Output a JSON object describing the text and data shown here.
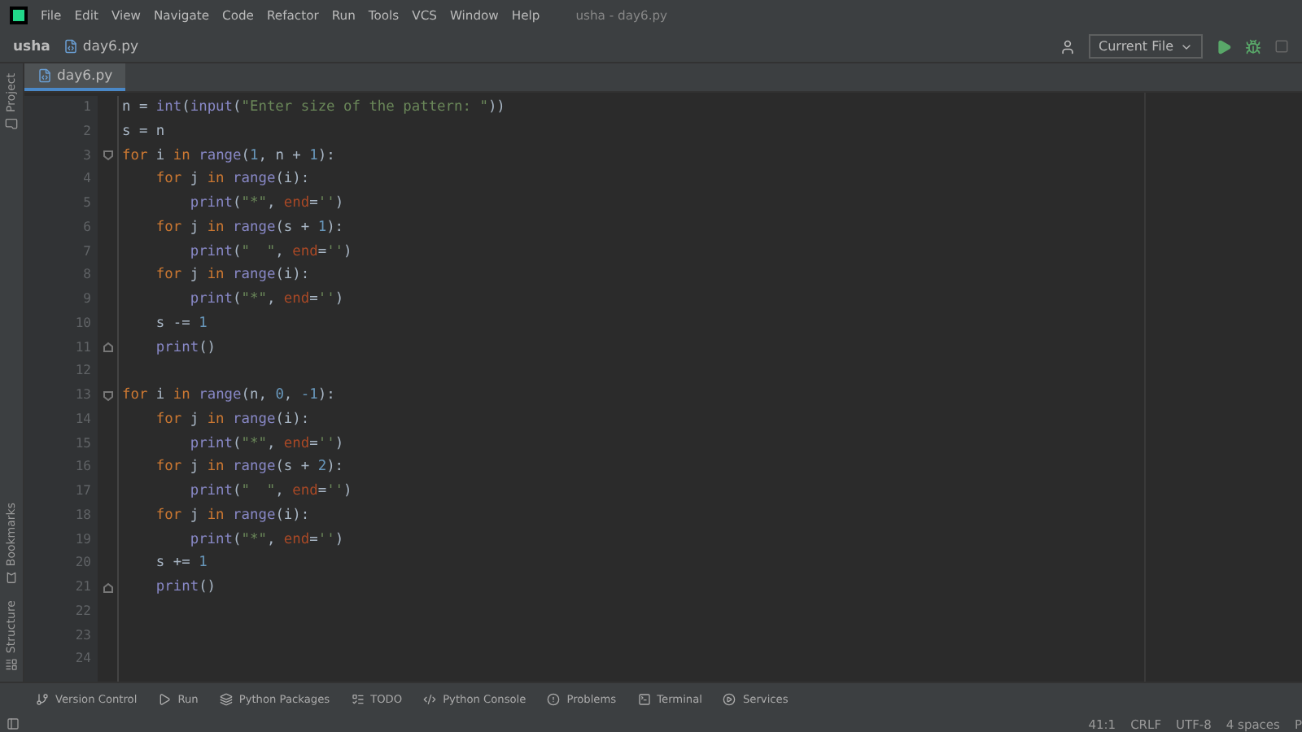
{
  "menu": [
    "File",
    "Edit",
    "View",
    "Navigate",
    "Code",
    "Refactor",
    "Run",
    "Tools",
    "VCS",
    "Window",
    "Help"
  ],
  "window": {
    "title": "usha - day6.py"
  },
  "navbar": {
    "project": "usha",
    "file": "day6.py",
    "run_config": "Current File"
  },
  "tabs": [
    {
      "label": "day6.py",
      "selected": true
    }
  ],
  "side_tools_top": [
    "Project"
  ],
  "side_tools_bottom": [
    "Bookmarks",
    "Structure"
  ],
  "editor": {
    "lines": [
      {
        "number": "1",
        "tokens": [
          {
            "kind": "plain",
            "t": "n = "
          },
          {
            "kind": "builtin",
            "t": "int"
          },
          {
            "kind": "plain",
            "t": "("
          },
          {
            "kind": "builtin",
            "t": "input"
          },
          {
            "kind": "plain",
            "t": "("
          },
          {
            "kind": "str",
            "t": "\"Enter size of the pattern: \""
          },
          {
            "kind": "plain",
            "t": "))"
          }
        ]
      },
      {
        "number": "2",
        "tokens": [
          {
            "kind": "plain",
            "t": "s = n"
          }
        ]
      },
      {
        "number": "3",
        "kind": "opener",
        "tokens": [
          {
            "kind": "kw",
            "t": "for"
          },
          {
            "kind": "plain",
            "t": " i "
          },
          {
            "kind": "kw",
            "t": "in"
          },
          {
            "kind": "builtin",
            "t": " range"
          },
          {
            "kind": "plain",
            "t": "("
          },
          {
            "kind": "num",
            "t": "1"
          },
          {
            "kind": "plain",
            "t": ", n + "
          },
          {
            "kind": "num",
            "t": "1"
          },
          {
            "kind": "plain",
            "t": "):"
          }
        ]
      },
      {
        "number": "4",
        "tokens": [
          {
            "kind": "kw",
            "t": "    for"
          },
          {
            "kind": "plain",
            "t": " j "
          },
          {
            "kind": "kw",
            "t": "in"
          },
          {
            "kind": "builtin",
            "t": " range"
          },
          {
            "kind": "plain",
            "t": "(i):"
          }
        ]
      },
      {
        "number": "5",
        "tokens": [
          {
            "kind": "builtin",
            "t": "        print"
          },
          {
            "kind": "plain",
            "t": "("
          },
          {
            "kind": "str",
            "t": "\"*\""
          },
          {
            "kind": "plain",
            "t": ", "
          },
          {
            "kind": "param",
            "t": "end"
          },
          {
            "kind": "plain",
            "t": "="
          },
          {
            "kind": "str",
            "t": "''"
          },
          {
            "kind": "plain",
            "t": ")"
          }
        ]
      },
      {
        "number": "6",
        "tokens": [
          {
            "kind": "kw",
            "t": "    for"
          },
          {
            "kind": "plain",
            "t": " j "
          },
          {
            "kind": "kw",
            "t": "in"
          },
          {
            "kind": "builtin",
            "t": " range"
          },
          {
            "kind": "plain",
            "t": "(s + "
          },
          {
            "kind": "num",
            "t": "1"
          },
          {
            "kind": "plain",
            "t": "):"
          }
        ]
      },
      {
        "number": "7",
        "tokens": [
          {
            "kind": "builtin",
            "t": "        print"
          },
          {
            "kind": "plain",
            "t": "("
          },
          {
            "kind": "str",
            "t": "\"  \""
          },
          {
            "kind": "plain",
            "t": ", "
          },
          {
            "kind": "param",
            "t": "end"
          },
          {
            "kind": "plain",
            "t": "="
          },
          {
            "kind": "str",
            "t": "''"
          },
          {
            "kind": "plain",
            "t": ")"
          }
        ]
      },
      {
        "number": "8",
        "tokens": [
          {
            "kind": "kw",
            "t": "    for"
          },
          {
            "kind": "plain",
            "t": " j "
          },
          {
            "kind": "kw",
            "t": "in"
          },
          {
            "kind": "builtin",
            "t": " range"
          },
          {
            "kind": "plain",
            "t": "(i):"
          }
        ]
      },
      {
        "number": "9",
        "tokens": [
          {
            "kind": "builtin",
            "t": "        print"
          },
          {
            "kind": "plain",
            "t": "("
          },
          {
            "kind": "str",
            "t": "\"*\""
          },
          {
            "kind": "plain",
            "t": ", "
          },
          {
            "kind": "param",
            "t": "end"
          },
          {
            "kind": "plain",
            "t": "="
          },
          {
            "kind": "str",
            "t": "''"
          },
          {
            "kind": "plain",
            "t": ")"
          }
        ]
      },
      {
        "number": "10",
        "tokens": [
          {
            "kind": "plain",
            "t": "    s -= "
          },
          {
            "kind": "num",
            "t": "1"
          }
        ]
      },
      {
        "number": "11",
        "kind": "closer",
        "tokens": [
          {
            "kind": "builtin",
            "t": "    print"
          },
          {
            "kind": "plain",
            "t": "()"
          }
        ]
      },
      {
        "number": "12"
      },
      {
        "number": "13",
        "kind": "opener",
        "tokens": [
          {
            "kind": "kw",
            "t": "for"
          },
          {
            "kind": "plain",
            "t": " i "
          },
          {
            "kind": "kw",
            "t": "in"
          },
          {
            "kind": "builtin",
            "t": " range"
          },
          {
            "kind": "plain",
            "t": "(n, "
          },
          {
            "kind": "num",
            "t": "0"
          },
          {
            "kind": "plain",
            "t": ", "
          },
          {
            "kind": "num",
            "t": "-1"
          },
          {
            "kind": "plain",
            "t": "):"
          }
        ]
      },
      {
        "number": "14",
        "tokens": [
          {
            "kind": "kw",
            "t": "    for"
          },
          {
            "kind": "plain",
            "t": " j "
          },
          {
            "kind": "kw",
            "t": "in"
          },
          {
            "kind": "builtin",
            "t": " range"
          },
          {
            "kind": "plain",
            "t": "(i):"
          }
        ]
      },
      {
        "number": "15",
        "tokens": [
          {
            "kind": "builtin",
            "t": "        print"
          },
          {
            "kind": "plain",
            "t": "("
          },
          {
            "kind": "str",
            "t": "\"*\""
          },
          {
            "kind": "plain",
            "t": ", "
          },
          {
            "kind": "param",
            "t": "end"
          },
          {
            "kind": "plain",
            "t": "="
          },
          {
            "kind": "str",
            "t": "''"
          },
          {
            "kind": "plain",
            "t": ")"
          }
        ]
      },
      {
        "number": "16",
        "tokens": [
          {
            "kind": "kw",
            "t": "    for"
          },
          {
            "kind": "plain",
            "t": " j "
          },
          {
            "kind": "kw",
            "t": "in"
          },
          {
            "kind": "builtin",
            "t": " range"
          },
          {
            "kind": "plain",
            "t": "(s + "
          },
          {
            "kind": "num",
            "t": "2"
          },
          {
            "kind": "plain",
            "t": "):"
          }
        ]
      },
      {
        "number": "17",
        "tokens": [
          {
            "kind": "builtin",
            "t": "        print"
          },
          {
            "kind": "plain",
            "t": "("
          },
          {
            "kind": "str",
            "t": "\"  \""
          },
          {
            "kind": "plain",
            "t": ", "
          },
          {
            "kind": "param",
            "t": "end"
          },
          {
            "kind": "plain",
            "t": "="
          },
          {
            "kind": "str",
            "t": "''"
          },
          {
            "kind": "plain",
            "t": ")"
          }
        ]
      },
      {
        "number": "18",
        "tokens": [
          {
            "kind": "kw",
            "t": "    for"
          },
          {
            "kind": "plain",
            "t": " j "
          },
          {
            "kind": "kw",
            "t": "in"
          },
          {
            "kind": "builtin",
            "t": " range"
          },
          {
            "kind": "plain",
            "t": "(i):"
          }
        ]
      },
      {
        "number": "19",
        "tokens": [
          {
            "kind": "builtin",
            "t": "        print"
          },
          {
            "kind": "plain",
            "t": "("
          },
          {
            "kind": "str",
            "t": "\"*\""
          },
          {
            "kind": "plain",
            "t": ", "
          },
          {
            "kind": "param",
            "t": "end"
          },
          {
            "kind": "plain",
            "t": "="
          },
          {
            "kind": "str",
            "t": "''"
          },
          {
            "kind": "plain",
            "t": ")"
          }
        ]
      },
      {
        "number": "20",
        "tokens": [
          {
            "kind": "plain",
            "t": "    s += "
          },
          {
            "kind": "num",
            "t": "1"
          }
        ]
      },
      {
        "number": "21",
        "kind": "closer",
        "tokens": [
          {
            "kind": "builtin",
            "t": "    print"
          },
          {
            "kind": "plain",
            "t": "()"
          }
        ]
      },
      {
        "number": "22"
      },
      {
        "number": "23"
      },
      {
        "number": "24"
      }
    ]
  },
  "tool_windows": [
    "Version Control",
    "Run",
    "Python Packages",
    "TODO",
    "Python Console",
    "Problems",
    "Terminal",
    "Services"
  ],
  "status_bar": [
    "41:1",
    "CRLF",
    "UTF-8",
    "4 spaces",
    "P"
  ]
}
